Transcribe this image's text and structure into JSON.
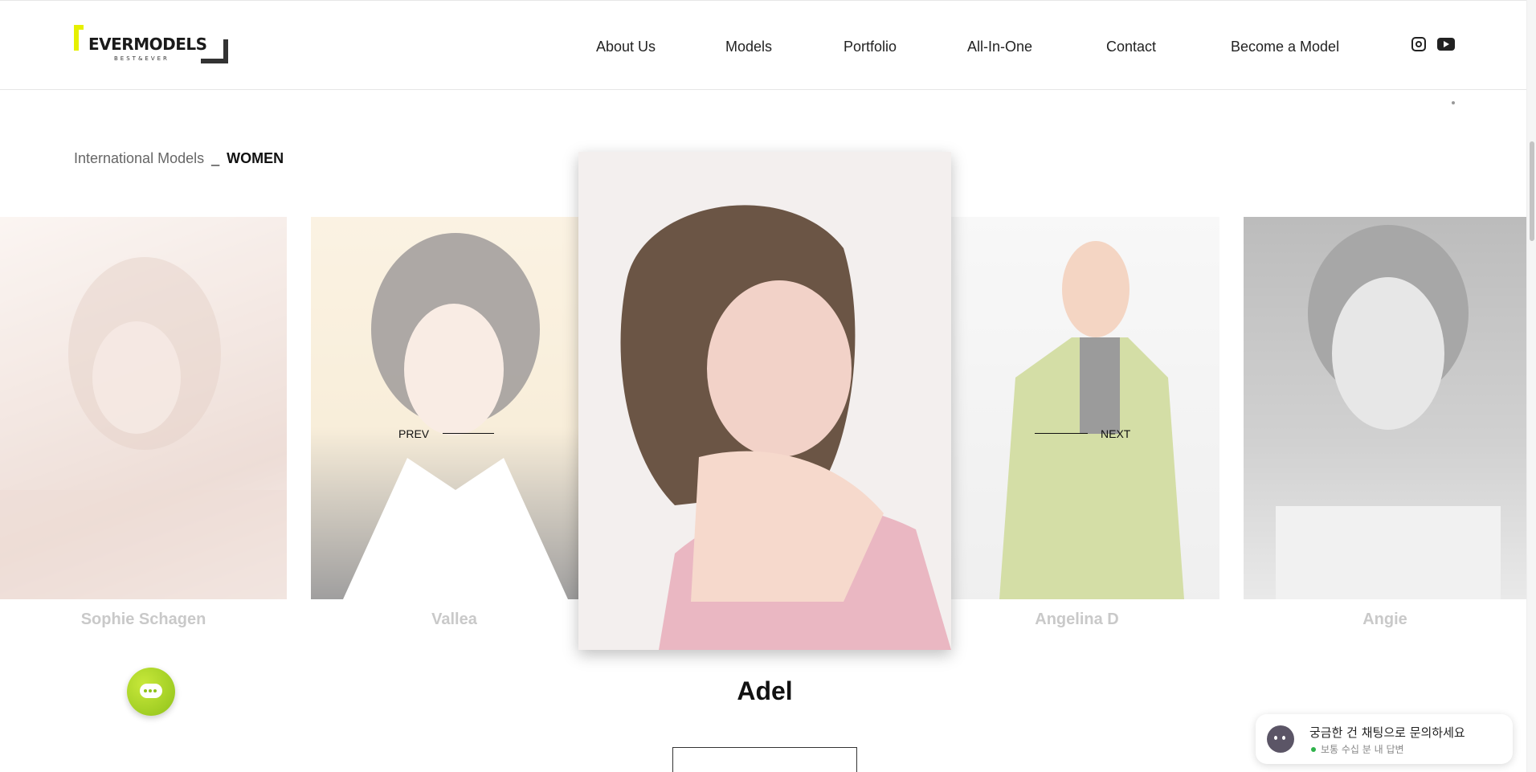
{
  "brand": {
    "logo_text": "EVERMODELS",
    "logo_sub": "BEST&EVER",
    "accent_color": "#e6f000"
  },
  "nav": {
    "items": [
      "About Us",
      "Models",
      "Portfolio",
      "All-In-One",
      "Contact",
      "Become a Model"
    ],
    "social": [
      "instagram-icon",
      "youtube-icon"
    ]
  },
  "breadcrumb": {
    "section": "International Models",
    "separator": "_",
    "category": "WOMEN"
  },
  "carousel": {
    "prev_label": "PREV",
    "next_label": "NEXT",
    "models": [
      {
        "name": "Sophie Schagen"
      },
      {
        "name": "Vallea"
      },
      {
        "name": "Adel",
        "featured": true
      },
      {
        "name": "Angelina D"
      },
      {
        "name": "Angie"
      }
    ]
  },
  "chat": {
    "fab_color": "#a8d62a",
    "message": "궁금한 건 채팅으로 문의하세요",
    "status": "보통 수십 분 내 답변"
  }
}
